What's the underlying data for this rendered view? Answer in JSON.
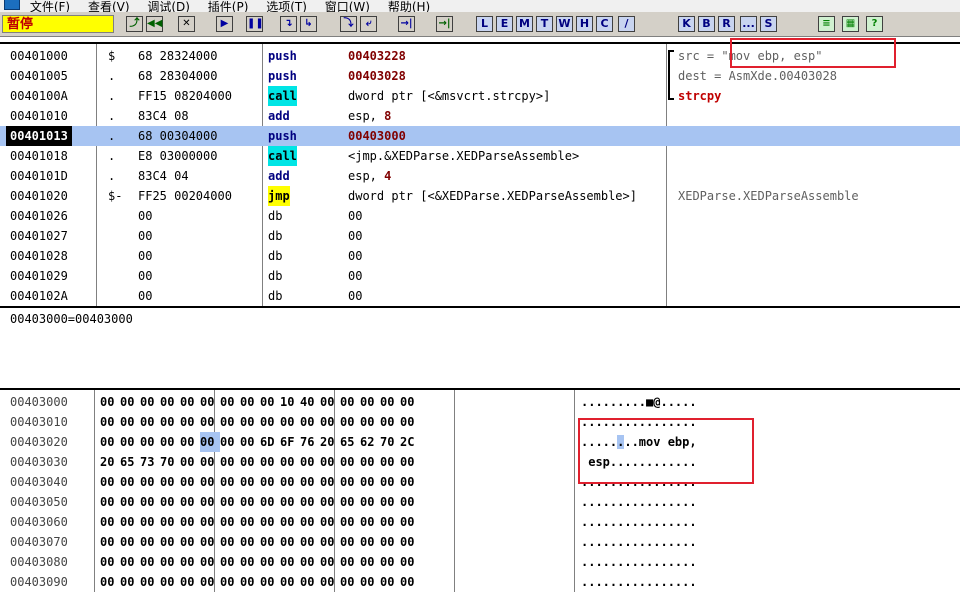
{
  "menu": {
    "items": [
      "文件(F)",
      "查看(V)",
      "调试(D)",
      "插件(P)",
      "选项(T)",
      "窗口(W)",
      "帮助(H)"
    ]
  },
  "toolbar": {
    "status": "暂停",
    "buttons": [
      {
        "label": "⤴",
        "style": "green"
      },
      {
        "label": "◀◀",
        "style": "green"
      },
      {
        "label": "✕",
        "style": ""
      },
      {
        "label": "▶",
        "style": "blue"
      },
      {
        "label": "❚❚",
        "style": "blue"
      },
      {
        "label": "↴",
        "style": "blue"
      },
      {
        "label": "↳",
        "style": "blue"
      },
      {
        "label": "⤵",
        "style": "blue"
      },
      {
        "label": "⤶",
        "style": "blue"
      },
      {
        "label": "→|",
        "style": "blue"
      },
      {
        "label": "→|",
        "style": "green"
      },
      {
        "label": "L",
        "style": "letter"
      },
      {
        "label": "E",
        "style": "letter"
      },
      {
        "label": "M",
        "style": "letter"
      },
      {
        "label": "T",
        "style": "letter"
      },
      {
        "label": "W",
        "style": "letter"
      },
      {
        "label": "H",
        "style": "letter"
      },
      {
        "label": "C",
        "style": "letter"
      },
      {
        "label": "/",
        "style": "letter"
      },
      {
        "label": "K",
        "style": "letter"
      },
      {
        "label": "B",
        "style": "letter"
      },
      {
        "label": "R",
        "style": "letter"
      },
      {
        "label": "...",
        "style": "letter"
      },
      {
        "label": "S",
        "style": "letter"
      },
      {
        "label": "≡",
        "style": "lgreen"
      },
      {
        "label": "▦",
        "style": "lgreen"
      },
      {
        "label": "?",
        "style": "lgreen"
      }
    ]
  },
  "disasm": {
    "rows": [
      {
        "addr": "00401000",
        "mark": "$",
        "hex": "68 28324000",
        "mn": "push",
        "mnStyle": "",
        "op": "00403228",
        "opStyle": "num",
        "comment": "src = \"mov ebp, esp\"",
        "cStyle": ""
      },
      {
        "addr": "00401005",
        "mark": ".",
        "hex": "68 28304000",
        "mn": "push",
        "mnStyle": "",
        "op": "00403028",
        "opStyle": "num",
        "comment": "dest = AsmXde.00403028",
        "cStyle": ""
      },
      {
        "addr": "0040100A",
        "mark": ".",
        "hex": "FF15 08204000",
        "mn": "call",
        "mnStyle": "call",
        "op": "dword ptr [<&msvcrt.strcpy>]",
        "opStyle": "",
        "comment": "strcpy",
        "cStyle": "red"
      },
      {
        "addr": "00401010",
        "mark": ".",
        "hex": "83C4 08",
        "mn": "add",
        "mnStyle": "plain",
        "op": "esp, ",
        "opImm": "8",
        "opStyle": "",
        "comment": "",
        "cStyle": ""
      },
      {
        "addr": "00401013",
        "mark": ".",
        "hex": "68 00304000",
        "mn": "push",
        "mnStyle": "",
        "op": "00403000",
        "opStyle": "num",
        "comment": "",
        "cStyle": "",
        "selected": true
      },
      {
        "addr": "00401018",
        "mark": ".",
        "hex": "E8 03000000",
        "mn": "call",
        "mnStyle": "call",
        "op": "<jmp.&XEDParse.XEDParseAssemble>",
        "opStyle": "",
        "comment": "",
        "cStyle": ""
      },
      {
        "addr": "0040101D",
        "mark": ".",
        "hex": "83C4 04",
        "mn": "add",
        "mnStyle": "plain",
        "op": "esp, ",
        "opImm": "4",
        "opStyle": "",
        "comment": "",
        "cStyle": ""
      },
      {
        "addr": "00401020",
        "mark": "$-",
        "hex": "FF25 00204000",
        "mn": "jmp",
        "mnStyle": "jmp",
        "op": "dword ptr [<&XEDParse.XEDParseAssemble>]",
        "opStyle": "",
        "comment": "XEDParse.XEDParseAssemble",
        "cStyle": ""
      },
      {
        "addr": "00401026",
        "mark": "",
        "hex": "00",
        "mn": "db",
        "mnStyle": "db",
        "op": "00",
        "opStyle": "",
        "comment": "",
        "cStyle": ""
      },
      {
        "addr": "00401027",
        "mark": "",
        "hex": "00",
        "mn": "db",
        "mnStyle": "db",
        "op": "00",
        "opStyle": "",
        "comment": "",
        "cStyle": ""
      },
      {
        "addr": "00401028",
        "mark": "",
        "hex": "00",
        "mn": "db",
        "mnStyle": "db",
        "op": "00",
        "opStyle": "",
        "comment": "",
        "cStyle": ""
      },
      {
        "addr": "00401029",
        "mark": "",
        "hex": "00",
        "mn": "db",
        "mnStyle": "db",
        "op": "00",
        "opStyle": "",
        "comment": "",
        "cStyle": ""
      },
      {
        "addr": "0040102A",
        "mark": "",
        "hex": "00",
        "mn": "db",
        "mnStyle": "db",
        "op": "00",
        "opStyle": "",
        "comment": "",
        "cStyle": ""
      }
    ]
  },
  "info": {
    "text": "00403000=00403000"
  },
  "dump": {
    "rows": [
      {
        "addr": "00403000",
        "bytes": [
          "00",
          "00",
          "00",
          "00",
          "00",
          "00",
          "00",
          "00",
          "00",
          "10",
          "40",
          "00",
          "00",
          "00",
          "00",
          "00"
        ],
        "ascii": ".........■@....."
      },
      {
        "addr": "00403010",
        "bytes": [
          "00",
          "00",
          "00",
          "00",
          "00",
          "00",
          "00",
          "00",
          "00",
          "00",
          "00",
          "00",
          "00",
          "00",
          "00",
          "00"
        ],
        "ascii": "................"
      },
      {
        "addr": "00403020",
        "bytes": [
          "00",
          "00",
          "00",
          "00",
          "00",
          "00",
          "00",
          "00",
          "6D",
          "6F",
          "76",
          "20",
          "65",
          "62",
          "70",
          "2C"
        ],
        "ascii": "........mov ebp,",
        "hlByte": 5,
        "hlChar": 5
      },
      {
        "addr": "00403030",
        "bytes": [
          "20",
          "65",
          "73",
          "70",
          "00",
          "00",
          "00",
          "00",
          "00",
          "00",
          "00",
          "00",
          "00",
          "00",
          "00",
          "00"
        ],
        "ascii": " esp............"
      },
      {
        "addr": "00403040",
        "bytes": [
          "00",
          "00",
          "00",
          "00",
          "00",
          "00",
          "00",
          "00",
          "00",
          "00",
          "00",
          "00",
          "00",
          "00",
          "00",
          "00"
        ],
        "ascii": "................"
      },
      {
        "addr": "00403050",
        "bytes": [
          "00",
          "00",
          "00",
          "00",
          "00",
          "00",
          "00",
          "00",
          "00",
          "00",
          "00",
          "00",
          "00",
          "00",
          "00",
          "00"
        ],
        "ascii": "................"
      },
      {
        "addr": "00403060",
        "bytes": [
          "00",
          "00",
          "00",
          "00",
          "00",
          "00",
          "00",
          "00",
          "00",
          "00",
          "00",
          "00",
          "00",
          "00",
          "00",
          "00"
        ],
        "ascii": "................"
      },
      {
        "addr": "00403070",
        "bytes": [
          "00",
          "00",
          "00",
          "00",
          "00",
          "00",
          "00",
          "00",
          "00",
          "00",
          "00",
          "00",
          "00",
          "00",
          "00",
          "00"
        ],
        "ascii": "................"
      },
      {
        "addr": "00403080",
        "bytes": [
          "00",
          "00",
          "00",
          "00",
          "00",
          "00",
          "00",
          "00",
          "00",
          "00",
          "00",
          "00",
          "00",
          "00",
          "00",
          "00"
        ],
        "ascii": "................"
      },
      {
        "addr": "00403090",
        "bytes": [
          "00",
          "00",
          "00",
          "00",
          "00",
          "00",
          "00",
          "00",
          "00",
          "00",
          "00",
          "00",
          "00",
          "00",
          "00",
          "00"
        ],
        "ascii": "................"
      }
    ]
  },
  "colors": {
    "selection": "#a7c4f2",
    "annotation": "#e0202e",
    "callHighlight": "#00e5e5",
    "jmpHighlight": "#ffff00"
  }
}
